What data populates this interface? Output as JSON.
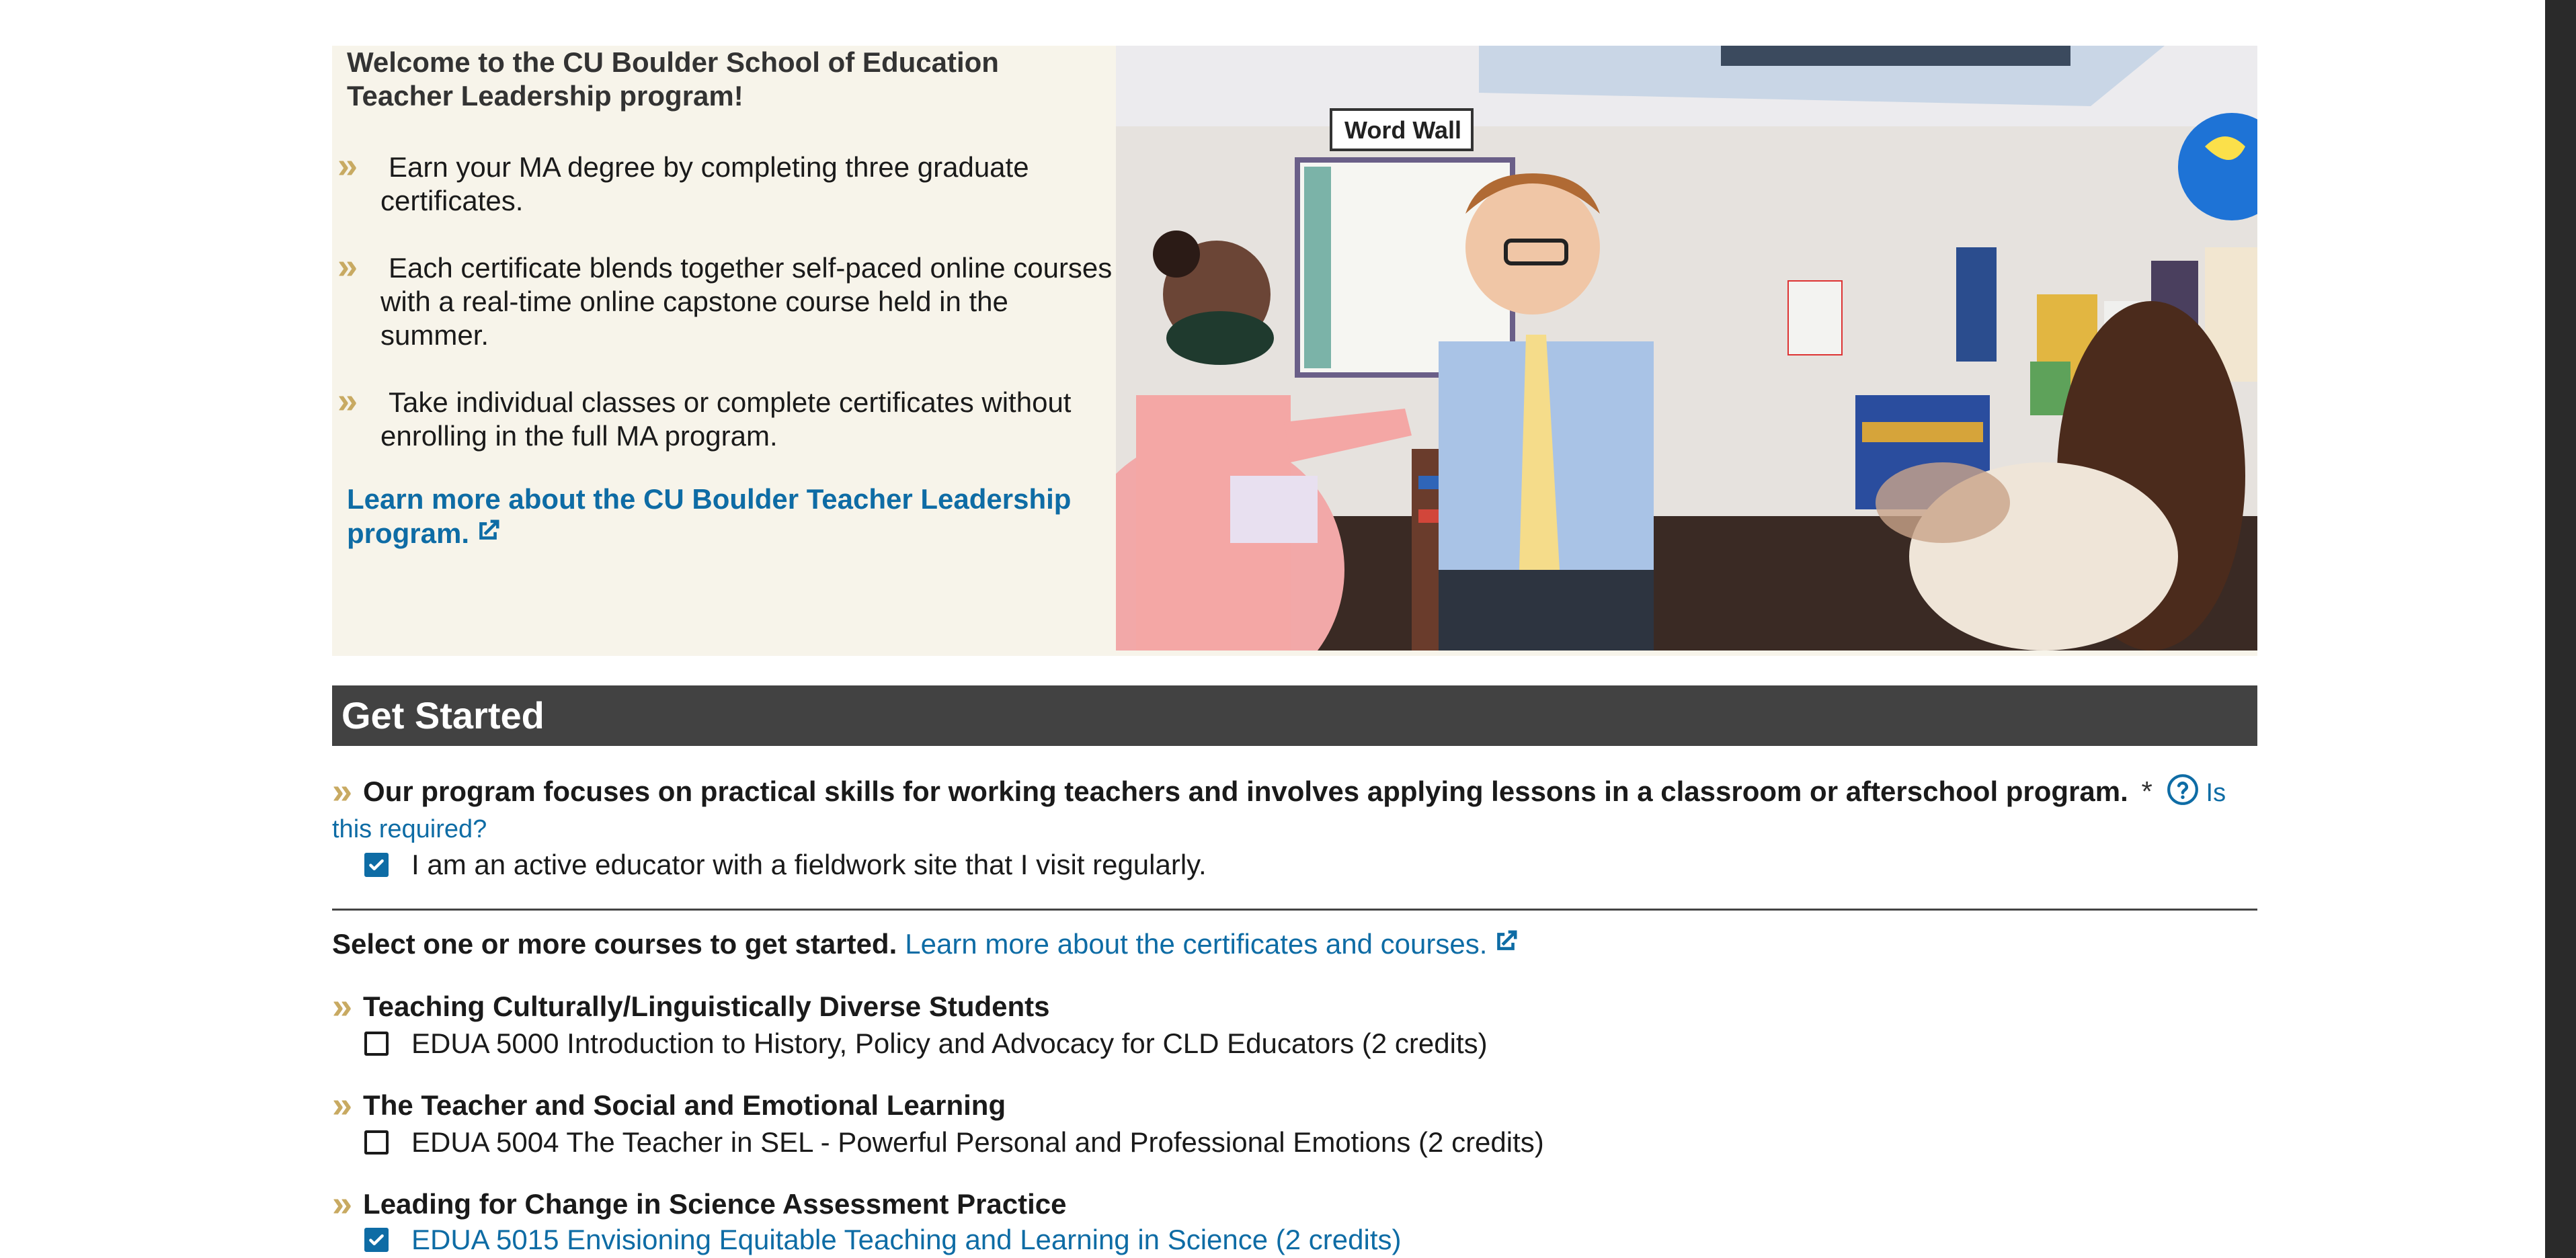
{
  "intro": {
    "welcome": "Welcome to the CU Boulder School of Education Teacher Leadership program!",
    "bullets": [
      "Earn your MA degree by completing three graduate certificates.",
      "Each certificate blends together self-paced online courses with a real-time online capstone course held in the summer.",
      "Take individual classes or complete certificates without enrolling in the full MA program."
    ],
    "learn_more_link": "Learn more about the CU Boulder Teacher Leadership program.",
    "photo_sign": "Word Wall"
  },
  "get_started": {
    "heading": "Get Started",
    "question": "Our program focuses on practical skills for working teachers and involves applying lessons in a classroom or afterschool program.",
    "required_marker": "*",
    "help_link": "Is this required?",
    "educator_checkbox": {
      "label": "I am an active educator with a fieldwork site that I visit regularly.",
      "checked": true
    },
    "select_prompt": "Select one or more courses to get started.",
    "certificates_link": "Learn more about the certificates and courses."
  },
  "course_groups": [
    {
      "title": "Teaching Culturally/Linguistically Diverse Students",
      "courses": [
        {
          "label": "EDUA 5000 Introduction to History, Policy and Advocacy for CLD Educators (2 credits)",
          "checked": false
        }
      ]
    },
    {
      "title": "The Teacher and Social and Emotional Learning",
      "courses": [
        {
          "label": "EDUA 5004 The Teacher in SEL - Powerful Personal and Professional Emotions (2 credits)",
          "checked": false
        }
      ]
    },
    {
      "title": "Leading for Change in Science Assessment Practice",
      "courses": [
        {
          "label": "EDUA 5015 Envisioning Equitable Teaching and Learning in Science (2 credits)",
          "checked": true
        }
      ]
    }
  ],
  "colors": {
    "accent_gold": "#c8aa62",
    "link_blue": "#0e6ca5",
    "section_bar": "#424242",
    "hero_bg": "#f7f4ea"
  }
}
